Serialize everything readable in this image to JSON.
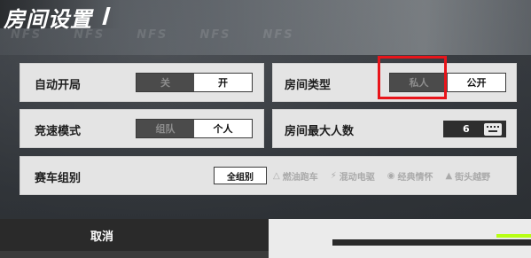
{
  "header": {
    "title": "房间设置",
    "bg_marks": [
      "NFS",
      "NFS",
      "NFS",
      "NFS",
      "NFS"
    ]
  },
  "auto_start": {
    "label": "自动开局",
    "options": [
      "关",
      "开"
    ],
    "selected": "开"
  },
  "room_type": {
    "label": "房间类型",
    "options": [
      "私人",
      "公开"
    ],
    "selected": "公开",
    "highlight_color": "#e8141a"
  },
  "race_mode": {
    "label": "竞速模式",
    "options": [
      "组队",
      "个人"
    ],
    "selected": "个人"
  },
  "max_players": {
    "label": "房间最大人数",
    "value": "6",
    "icon": "keyboard-icon"
  },
  "car_group": {
    "label": "赛车组别",
    "groups": [
      {
        "label": "全组别",
        "icon": ""
      },
      {
        "label": "燃油跑车",
        "icon": "flame-icon"
      },
      {
        "label": "混动电驱",
        "icon": "bolt-icon"
      },
      {
        "label": "经典情怀",
        "icon": "classic-icon"
      },
      {
        "label": "街头越野",
        "icon": "offroad-icon"
      }
    ],
    "selected": "全组别"
  },
  "footer": {
    "cancel_label": "取消"
  },
  "colors": {
    "panel": "#e4e4e4",
    "toggle_off": "#4b4b4b",
    "accent_green": "#b8ff14"
  }
}
